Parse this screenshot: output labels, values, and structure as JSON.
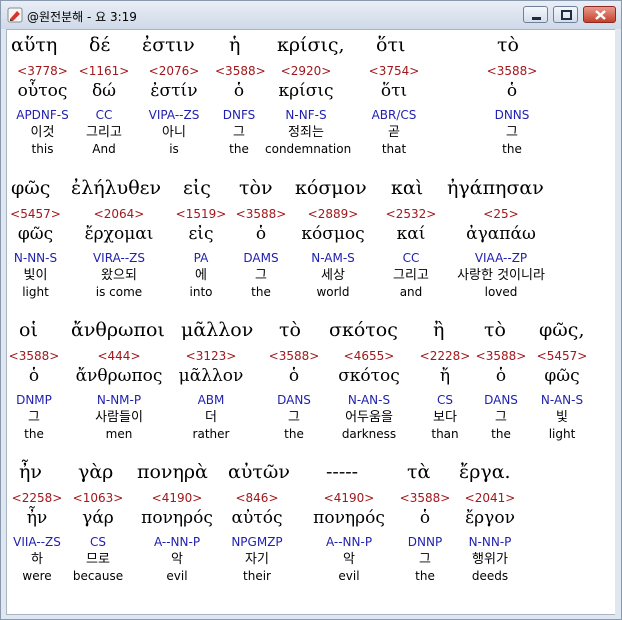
{
  "window": {
    "title": "@원전분해 - 요 3:19",
    "minimize_label": "Minimize",
    "maximize_label": "Maximize",
    "close_label": "Close"
  },
  "colors": {
    "strong": "#a0181c",
    "parse": "#1f1fb0",
    "text": "#000000"
  },
  "lines": [
    {
      "greek": [
        "αὕτη",
        "δέ",
        "ἐστιν",
        "ἡ",
        "κρίσις,",
        "ὅτι",
        "",
        "τὸ"
      ],
      "tokens": [
        {
          "strong": "<3778>",
          "lexeme": "οὗτος",
          "parse": "APDNF-S",
          "korean": "이것",
          "english": "this"
        },
        {
          "strong": "<1161>",
          "lexeme": "δώ",
          "parse": "CC",
          "korean": "그리고",
          "english": "And"
        },
        {
          "strong": "<2076>",
          "lexeme": "ἐστίν",
          "parse": "VIPA--ZS",
          "korean": "아니",
          "english": "is"
        },
        {
          "strong": "<3588>",
          "lexeme": "ὁ",
          "parse": "DNFS",
          "korean": "그",
          "english": "the"
        },
        {
          "strong": "<2920>",
          "lexeme": "κρίσις",
          "parse": "N-NF-S",
          "korean": "정죄는",
          "english": "condemnation"
        },
        {
          "strong": "<3754>",
          "lexeme": "ὅτι",
          "parse": "ABR/CS",
          "korean": "곧",
          "english": "that"
        },
        {
          "strong": "<3588>",
          "lexeme": "ὁ",
          "parse": "DNNS",
          "korean": "그",
          "english": "the"
        }
      ]
    },
    {
      "greek": [
        "φῶς",
        "ἐλήλυθεν",
        "εἰς",
        "τὸν",
        "κόσμον",
        "καὶ",
        "ἠγάπησαν"
      ],
      "tokens": [
        {
          "strong": "<5457>",
          "lexeme": "φῶς",
          "parse": "N-NN-S",
          "korean": "빛이",
          "english": "light"
        },
        {
          "strong": "<2064>",
          "lexeme": "ἔρχομαι",
          "parse": "VIRA--ZS",
          "korean": "왔으되",
          "english": "is come"
        },
        {
          "strong": "<1519>",
          "lexeme": "εἰς",
          "parse": "PA",
          "korean": "에",
          "english": "into"
        },
        {
          "strong": "<3588>",
          "lexeme": "ὁ",
          "parse": "DAMS",
          "korean": "그",
          "english": "the"
        },
        {
          "strong": "<2889>",
          "lexeme": "κόσμος",
          "parse": "N-AM-S",
          "korean": "세상",
          "english": "world"
        },
        {
          "strong": "<2532>",
          "lexeme": "καί",
          "parse": "CC",
          "korean": "그리고",
          "english": "and"
        },
        {
          "strong": "<25>",
          "lexeme": "ἀγαπάω",
          "parse": "VIAA--ZP",
          "korean": "사랑한 것이니라",
          "english": "loved"
        }
      ]
    },
    {
      "greek": [
        "οἱ",
        "ἄνθρωποι",
        "μᾶλλον",
        "τὸ",
        "σκότος",
        "ἢ",
        "τὸ",
        "φῶς,"
      ],
      "tokens": [
        {
          "strong": "<3588>",
          "lexeme": "ὁ",
          "parse": "DNMP",
          "korean": "그",
          "english": "the"
        },
        {
          "strong": "<444>",
          "lexeme": "ἄνθρωπος",
          "parse": "N-NM-P",
          "korean": "사람들이",
          "english": "men"
        },
        {
          "strong": "<3123>",
          "lexeme": "μᾶλλον",
          "parse": "ABM",
          "korean": "더",
          "english": "rather"
        },
        {
          "strong": "<3588>",
          "lexeme": "ὁ",
          "parse": "DANS",
          "korean": "그",
          "english": "the"
        },
        {
          "strong": "<4655>",
          "lexeme": "σκότος",
          "parse": "N-AN-S",
          "korean": "어두움을",
          "english": "darkness"
        },
        {
          "strong": "<2228>",
          "lexeme": "ἤ",
          "parse": "CS",
          "korean": "보다",
          "english": "than"
        },
        {
          "strong": "<3588>",
          "lexeme": "ὁ",
          "parse": "DANS",
          "korean": "그",
          "english": "the"
        },
        {
          "strong": "<5457>",
          "lexeme": "φῶς",
          "parse": "N-AN-S",
          "korean": "빛",
          "english": "light"
        }
      ]
    },
    {
      "greek": [
        "ἦν",
        "γὰρ",
        "πονηρὰ",
        "αὐτῶν",
        "-----",
        "τὰ",
        "ἔργα."
      ],
      "tokens": [
        {
          "strong": "<2258>",
          "lexeme": "ἦν",
          "parse": "VIIA--ZS",
          "korean": "하",
          "english": "were"
        },
        {
          "strong": "<1063>",
          "lexeme": "γάρ",
          "parse": "CS",
          "korean": "므로",
          "english": "because"
        },
        {
          "strong": "<4190>",
          "lexeme": "πονηρός",
          "parse": "A--NN-P",
          "korean": "악",
          "english": "evil"
        },
        {
          "strong": "<846>",
          "lexeme": "αὐτός",
          "parse": "NPGMZP",
          "korean": "자기",
          "english": "their"
        },
        {
          "strong": "<4190>",
          "lexeme": "πονηρός",
          "parse": "A--NN-P",
          "korean": "악",
          "english": "evil"
        },
        {
          "strong": "<3588>",
          "lexeme": "ὁ",
          "parse": "DNNP",
          "korean": "그",
          "english": "the"
        },
        {
          "strong": "<2041>",
          "lexeme": "ἔργον",
          "parse": "N-NN-P",
          "korean": "행위가",
          "english": "deeds"
        }
      ]
    }
  ]
}
